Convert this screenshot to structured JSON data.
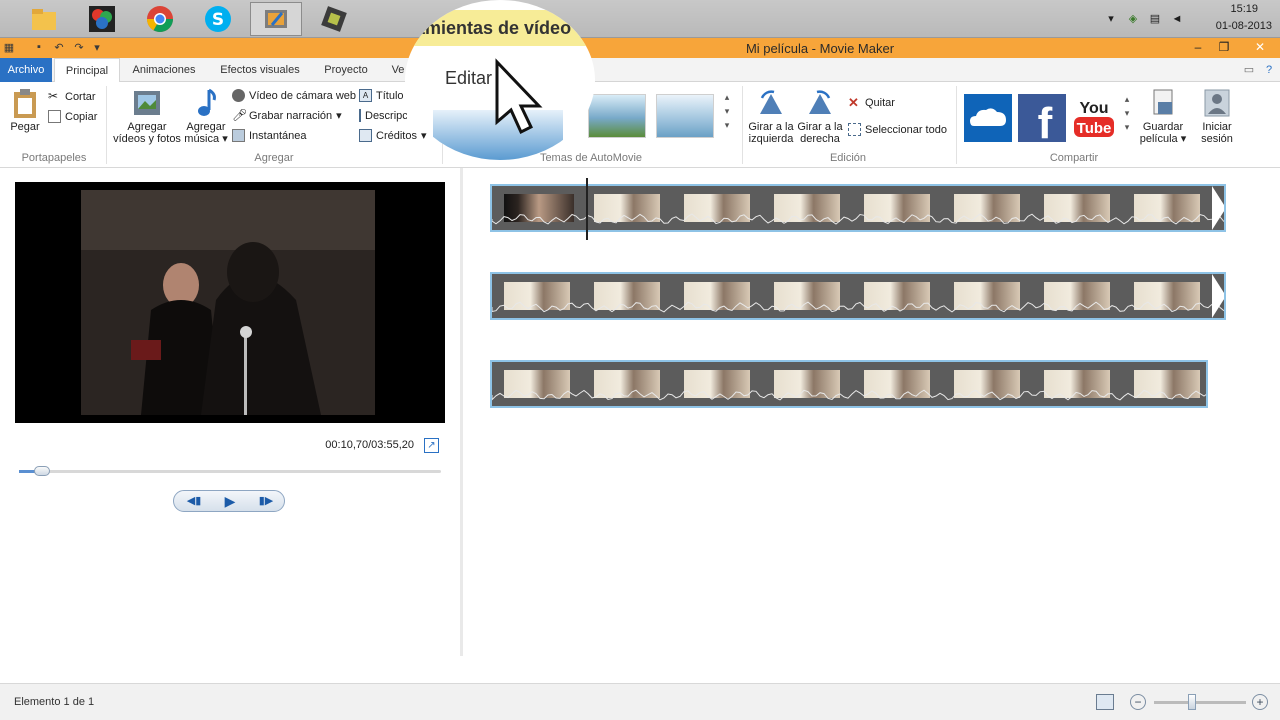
{
  "taskbar": {
    "apps": [
      {
        "name": "file-explorer",
        "active": false
      },
      {
        "name": "photo-app",
        "active": false
      },
      {
        "name": "chrome",
        "active": false
      },
      {
        "name": "skype",
        "active": false
      },
      {
        "name": "movie-maker",
        "active": true
      },
      {
        "name": "other-app",
        "active": false
      }
    ],
    "clock_time": "15:19",
    "clock_date": "01-08-2013"
  },
  "window": {
    "title": "Mi película - Movie Maker"
  },
  "magnifier": {
    "heading": "amientas de vídeo",
    "word": "Editar"
  },
  "ribbon": {
    "tabs": [
      "Archivo",
      "Principal",
      "Animaciones",
      "Efectos visuales",
      "Proyecto",
      "Ve"
    ],
    "clipboard": {
      "paste": "Pegar",
      "cut": "Cortar",
      "copy": "Copiar",
      "label": "Portapapeles"
    },
    "add": {
      "add_videos": "Agregar vídeos y fotos",
      "add_music": "Agregar música",
      "webcam": "Vídeo de cámara web",
      "narration": "Grabar narración",
      "snapshot": "Instantánea",
      "title": "Título",
      "caption": "Descripción",
      "credits": "Créditos",
      "label": "Agregar"
    },
    "themes": {
      "label": "Temas de AutoMovie"
    },
    "edit": {
      "rotate_left": "Girar a la izquierda",
      "rotate_right": "Girar a la derecha",
      "remove": "Quitar",
      "select_all": "Seleccionar todo",
      "label": "Edición"
    },
    "share": {
      "label": "Compartir",
      "save_movie": "Guardar película",
      "sign_in": "Iniciar sesión"
    }
  },
  "preview": {
    "timecode": "00:10,70/03:55,20",
    "progress": 0.05
  },
  "status": {
    "text": "Elemento 1 de 1"
  },
  "colors": {
    "title_bar": "#f7a53a",
    "file_tab": "#2a71c4",
    "selection_border": "#8ec3e6"
  }
}
